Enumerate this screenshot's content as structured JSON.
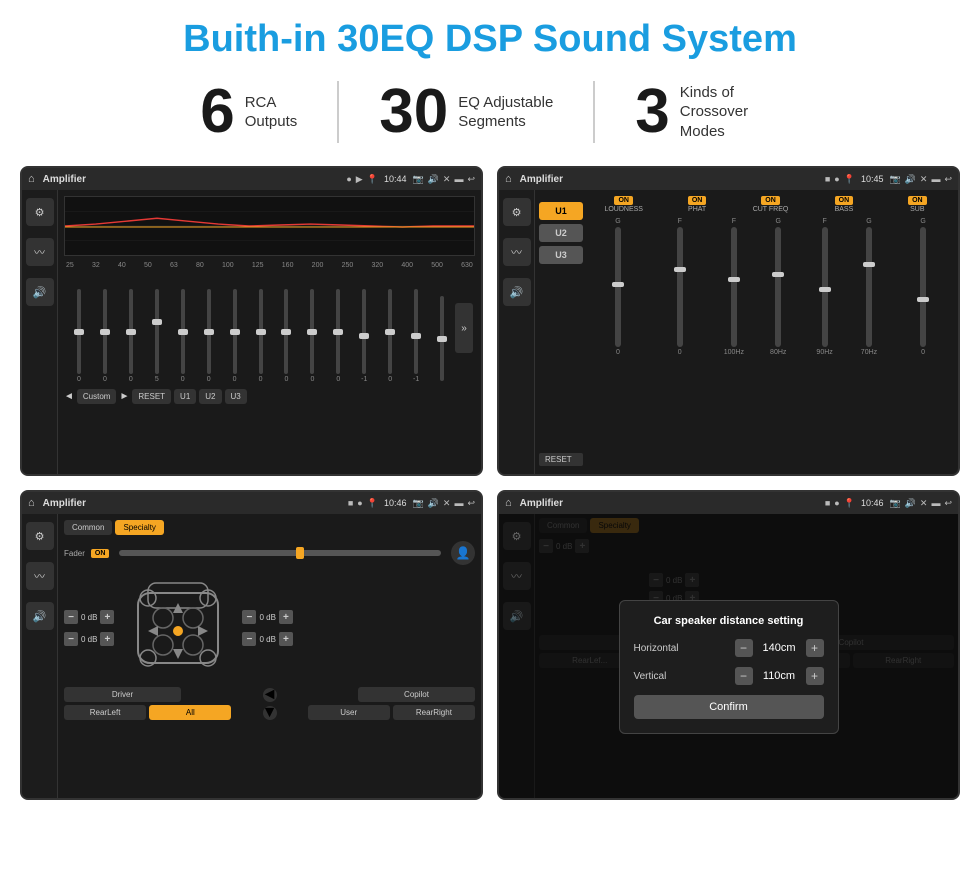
{
  "header": {
    "title": "Buith-in 30EQ DSP Sound System"
  },
  "stats": [
    {
      "number": "6",
      "label": "RCA\nOutputs"
    },
    {
      "number": "30",
      "label": "EQ Adjustable\nSegments"
    },
    {
      "number": "3",
      "label": "Kinds of\nCrossover Modes"
    }
  ],
  "screens": [
    {
      "id": "screen1",
      "topbar": {
        "title": "Amplifier",
        "time": "10:44"
      },
      "type": "eq"
    },
    {
      "id": "screen2",
      "topbar": {
        "title": "Amplifier",
        "time": "10:45"
      },
      "type": "amp2"
    },
    {
      "id": "screen3",
      "topbar": {
        "title": "Amplifier",
        "time": "10:46"
      },
      "type": "fader"
    },
    {
      "id": "screen4",
      "topbar": {
        "title": "Amplifier",
        "time": "10:46"
      },
      "type": "dialog"
    }
  ],
  "eq": {
    "freqs": [
      "25",
      "32",
      "40",
      "50",
      "63",
      "80",
      "100",
      "125",
      "160",
      "200",
      "250",
      "320",
      "400",
      "500",
      "630"
    ],
    "values": [
      "0",
      "0",
      "0",
      "5",
      "0",
      "0",
      "0",
      "0",
      "0",
      "0",
      "0",
      "-1",
      "0",
      "-1",
      ""
    ],
    "preset": "Custom",
    "buttons": [
      "RESET",
      "U1",
      "U2",
      "U3"
    ]
  },
  "amp2": {
    "users": [
      "U1",
      "U2",
      "U3"
    ],
    "labels": [
      "LOUDNESS",
      "PHAT",
      "CUT FREQ",
      "BASS",
      "SUB"
    ],
    "reset": "RESET"
  },
  "fader": {
    "tabs": [
      "Common",
      "Specialty"
    ],
    "fader_label": "Fader",
    "fader_on": "ON",
    "db_values": [
      "0 dB",
      "0 dB",
      "0 dB",
      "0 dB"
    ],
    "bottom_buttons": [
      "Driver",
      "",
      "",
      "",
      "",
      "Copilot"
    ],
    "bottom_row": [
      "RearLeft",
      "All",
      "",
      "User",
      "RearRight"
    ]
  },
  "dialog": {
    "title": "Car speaker distance setting",
    "horizontal_label": "Horizontal",
    "horizontal_value": "140cm",
    "vertical_label": "Vertical",
    "vertical_value": "110cm",
    "confirm_label": "Confirm",
    "tabs": [
      "Common",
      "Specialty"
    ],
    "db_right": [
      "0 dB",
      "0 dB"
    ],
    "bottom_left": "RearLef...",
    "bottom_right": "RearRight",
    "bottom_driver": "Driver",
    "bottom_copilot": "Copilot"
  }
}
